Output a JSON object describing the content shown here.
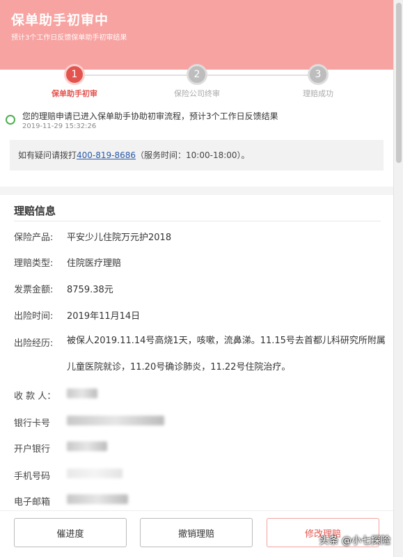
{
  "header": {
    "title": "保单助手初审中",
    "subtitle": "预计3个工作日反馈保单助手初审结果"
  },
  "steps": [
    {
      "num": "1",
      "label": "保单助手初审",
      "active": true
    },
    {
      "num": "2",
      "label": "保险公司终审",
      "active": false
    },
    {
      "num": "3",
      "label": "理赔成功",
      "active": false
    }
  ],
  "status": {
    "text": "您的理赔申请已进入保单助手协助初审流程，预计3个工作日反馈结果",
    "time": "2019-11-29 15:32:26"
  },
  "hotline": {
    "prefix": "如有疑问请拨打",
    "phone": "400-819-8686",
    "suffix": "（服务时间：10:00-18:00）。"
  },
  "claim": {
    "section_title": "理赔信息",
    "product_label": "保险产品:",
    "product_value": "平安少儿住院万元护2018",
    "type_label": "理赔类型:",
    "type_value": "住院医疗理赔",
    "amount_label": "发票金额:",
    "amount_value": "8759.38元",
    "date_label": "出险时间:",
    "date_value": "2019年11月14日",
    "history_label": "出险经历:",
    "history_value": "被保人2019.11.14号高烧1天，咳嗽，流鼻涕。11.15号去首都儿科研究所附属儿童医院就诊，11.20号确诊肺炎，11.22号住院治疗。",
    "payee_label": "收 款 人：",
    "bank_card_label": "银行卡号",
    "bank_label": "开户银行",
    "phone_label": "手机号码",
    "email_label": "电子邮箱"
  },
  "footer": {
    "progress_button": "催进度",
    "cancel_button": "撤销理赔",
    "edit_button": "修改理赔"
  },
  "watermark": "头条 @小七探险"
}
